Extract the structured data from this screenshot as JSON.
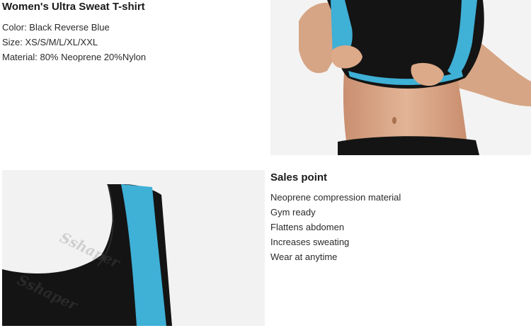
{
  "product": {
    "title": "Women's Ultra Sweat T-shirt",
    "color": "Color: Black Reverse Blue",
    "size": "Size: XS/S/M/L/XL/XXL",
    "material": "Material: 80% Neoprene 20%Nylon"
  },
  "photos": {
    "top": {
      "subject": "model-wearing-vest-icon"
    },
    "bottom": {
      "subject": "shoulder-strap-closeup-icon",
      "watermark": "Sshaper"
    }
  },
  "sales": {
    "title": "Sales point",
    "points": [
      "Neoprene compression material",
      "Gym ready",
      "Flattens abdomen",
      "Increases sweating",
      "Wear at anytime"
    ]
  },
  "colors": {
    "black": "#141414",
    "blue": "#3fb0d6",
    "skin": "#d9a98a"
  }
}
